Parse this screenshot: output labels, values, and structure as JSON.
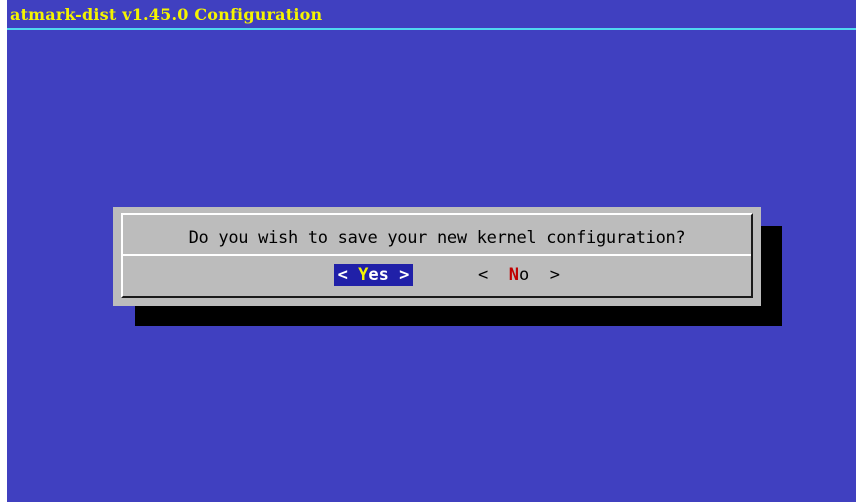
{
  "title": "atmark-dist v1.45.0 Configuration",
  "dialog": {
    "prompt": "Do you wish to save your new kernel configuration?",
    "buttons": {
      "yes": {
        "left_bracket": "<",
        "hotkey": "Y",
        "rest": "es",
        "right_bracket": ">",
        "selected": true
      },
      "no": {
        "left_bracket": "<",
        "hotkey": "N",
        "rest": "o",
        "right_bracket": ">",
        "selected": false
      }
    }
  },
  "colors": {
    "background": "#4040c0",
    "title_text": "#f4f400",
    "title_rule": "#50d8f0",
    "dialog_bg": "#bcbcbc",
    "shadow": "#000000",
    "selected_button_bg": "#2020a8",
    "hotkey_selected": "#f4f400",
    "hotkey_unselected": "#c00000"
  }
}
